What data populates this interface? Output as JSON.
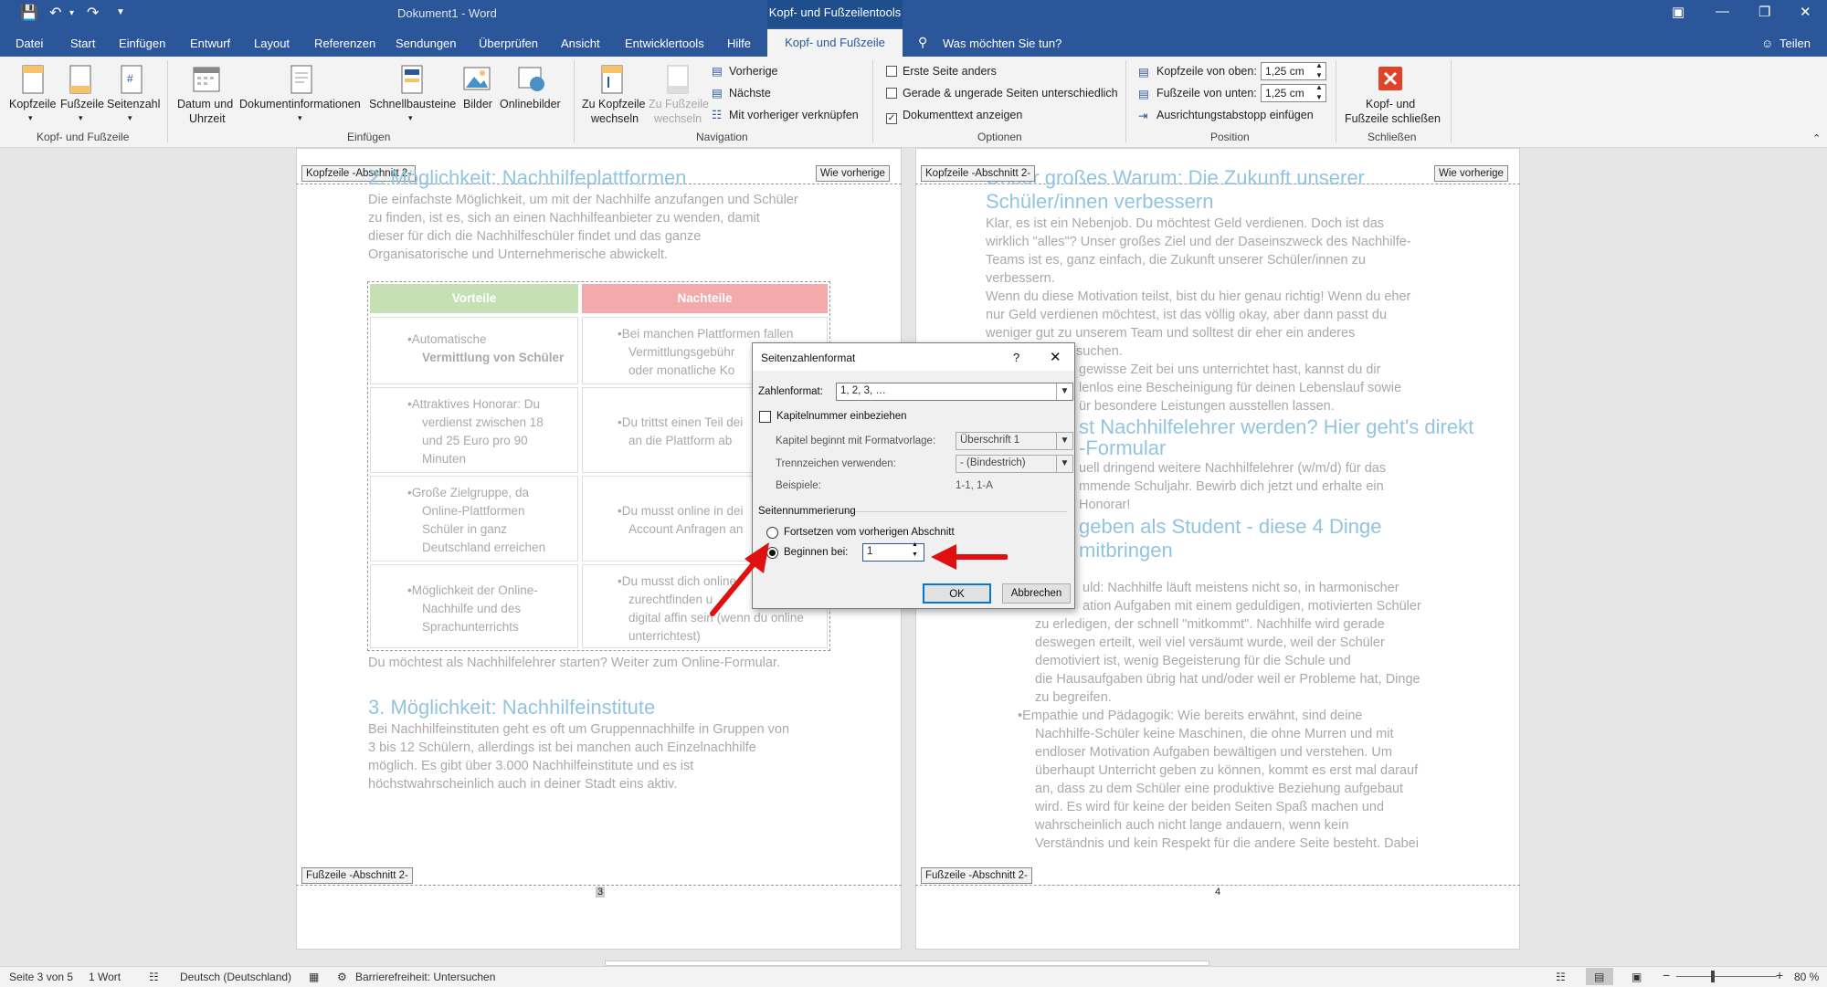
{
  "window": {
    "title": "Dokument1 - Word",
    "context_title": "Kopf- und Fußzeilentools"
  },
  "tabs": [
    "Datei",
    "Start",
    "Einfügen",
    "Entwurf",
    "Layout",
    "Referenzen",
    "Sendungen",
    "Überprüfen",
    "Ansicht",
    "Entwicklertools",
    "Hilfe"
  ],
  "active_tab": "Kopf- und Fußzeile",
  "tell_me": "Was möchten Sie tun?",
  "share": "Teilen",
  "ribbon": {
    "kopfzeile": "Kopfzeile",
    "fusszeile": "Fußzeile",
    "seitenzahl": "Seitenzahl",
    "grp_kf": "Kopf- und Fußzeile",
    "datum1": "Datum und",
    "datum2": "Uhrzeit",
    "dokinfo": "Dokumentinformationen",
    "schnell": "Schnellbausteine",
    "bilder": "Bilder",
    "online": "Onlinebilder",
    "grp_einf": "Einfügen",
    "zukopf1": "Zu Kopfzeile",
    "zukopf2": "wechseln",
    "zufuss1": "Zu Fußzeile",
    "zufuss2": "wechseln",
    "vorherige": "Vorherige",
    "naechste": "Nächste",
    "verknuepfen": "Mit vorheriger verknüpfen",
    "grp_nav": "Navigation",
    "opt1": "Erste Seite anders",
    "opt2": "Gerade & ungerade Seiten unterschiedlich",
    "opt3": "Dokumenttext anzeigen",
    "grp_opt": "Optionen",
    "kopfoben": "Kopfzeile von oben:",
    "kopfoben_val": "1,25 cm",
    "fussunten": "Fußzeile von unten:",
    "fussunten_val": "1,25 cm",
    "tabstopp": "Ausrichtungstabstopp einfügen",
    "grp_pos": "Position",
    "schliessen1": "Kopf- und",
    "schliessen2": "Fußzeile schließen",
    "grp_schl": "Schließen"
  },
  "page_left": {
    "header_tag": "Kopfzeile -Abschnitt 2-",
    "same_as_prev": "Wie vorherige",
    "heading1": "2. Möglichkeit: Nachhilfeplattformen",
    "para1": [
      "Die einfachste Möglichkeit, um mit der Nachhilfe anzufangen und Schüler",
      "zu finden, ist es, sich an einen Nachhilfeanbieter zu wenden, damit",
      "dieser für dich die Nachhilfeschüler findet und das ganze",
      "Organisatorische und Unternehmerische abwickelt."
    ],
    "table_head": [
      "Vorteile",
      "Nachteile"
    ],
    "table_left": [
      [
        "•Automatische",
        "Vermittlung von Schüler"
      ],
      [
        "•Attraktives Honorar: Du",
        "verdienst zwischen 18",
        "und 25 Euro pro 90",
        "Minuten"
      ],
      [
        "•Große Zielgruppe, da",
        "Online-Plattformen",
        "Schüler in ganz",
        "Deutschland erreichen"
      ],
      [
        "•Möglichkeit der Online-",
        "Nachhilfe und des",
        "Sprachunterrichts"
      ]
    ],
    "table_right": [
      [
        "•Bei manchen Plattformen fallen",
        "Vermittlungsgebühr",
        "oder monatliche Ko"
      ],
      [
        "•Du trittst einen Teil dei",
        "an die Plattform ab"
      ],
      [
        "•Du musst online in dei",
        "Account Anfragen an"
      ],
      [
        "•Du musst dich online",
        "zurechtfinden u",
        "digital affin sein (wenn du online",
        "unterrichtest)"
      ]
    ],
    "after_table": "Du möchtest als Nachhilfelehrer starten? Weiter zum Online-Formular.",
    "heading3": "3. Möglichkeit: Nachhilfeinstitute",
    "para3": [
      "Bei Nachhilfeinstituten geht es oft um Gruppennachhilfe in Gruppen von",
      "3 bis 12 Schülern, allerdings ist bei manchen auch Einzelnachhilfe",
      "möglich. Es gibt über 3.000 Nachhilfeinstitute und es ist",
      "höchstwahrscheinlich auch in deiner Stadt eins aktiv."
    ],
    "footer_tag": "Fußzeile -Abschnitt 2-",
    "page_num": "3"
  },
  "page_right": {
    "header_tag": "Kopfzeile -Abschnitt 2-",
    "same_as_prev": "Wie vorherige",
    "heading1a": "Unser großes Warum: Die Zukunft unserer",
    "heading1b": "Schüler/innen verbessern",
    "para1": [
      "Klar, es ist ein Nebenjob. Du möchtest Geld verdienen. Doch ist das",
      "wirklich \"alles\"? Unser großes Ziel und der Daseinszweck des Nachhilfe-",
      "Teams ist es, ganz einfach, die Zukunft unserer Schüler/innen zu",
      "verbessern.",
      "Wenn du diese Motivation teilst, bist du hier genau richtig! Wenn du eher",
      "nur Geld verdienen möchtest, ist das völlig okay, aber dann passt du",
      "weniger gut zu unserem Team und solltest dir eher ein anderes",
      "suchen."
    ],
    "para2": [
      "gewisse Zeit bei uns unterrichtet hast, kannst du dir",
      "lenlos eine Bescheinigung für deinen Lebenslauf sowie",
      "ür besondere Leistungen ausstellen lassen."
    ],
    "heading2a": "st Nachhilfelehrer werden? Hier geht's direkt",
    "heading2b": "-Formular",
    "para3": [
      "uell dringend weitere Nachhilfelehrer (w/m/d) für das",
      "mmende Schuljahr. Bewirb dich jetzt und erhalte ein",
      "Honorar!"
    ],
    "heading3a": "geben als Student - diese 4 Dinge",
    "heading3b": "mitbringen",
    "bullet1": [
      "uld: Nachhilfe läuft meistens nicht so, in harmonischer",
      "ation Aufgaben mit einem geduldigen, motivierten Schüler",
      "zu erledigen, der schnell \"mitkommt\". Nachhilfe wird gerade",
      "deswegen erteilt, weil viel versäumt wurde, weil der Schüler",
      "demotiviert ist, wenig Begeisterung für die Schule und",
      "die Hausaufgaben übrig hat und/oder weil er Probleme hat, Dinge",
      "zu begreifen."
    ],
    "bullet2": [
      "•Empathie und Pädagogik: Wie bereits erwähnt, sind deine",
      "Nachhilfe-Schüler keine Maschinen, die ohne Murren und mit",
      "endloser Motivation Aufgaben bewältigen und verstehen. Um",
      "überhaupt Unterricht geben zu können, kommt es erst mal darauf",
      "an, dass zu dem Schüler eine produktive Beziehung aufgebaut",
      "wird. Es wird für keine der beiden Seiten Spaß machen und",
      "wahrscheinlich auch nicht lange andauern, wenn kein",
      "Verständnis und kein Respekt für die andere Seite besteht. Dabei"
    ],
    "footer_tag": "Fußzeile -Abschnitt 2-",
    "page_num": "4"
  },
  "dialog": {
    "title": "Seitenzahlenformat",
    "help": "?",
    "close": "✕",
    "zahlenformat_label": "Zahlenformat:",
    "zahlenformat_val": "1, 2, 3, …",
    "kapitel_cb": "Kapitelnummer einbeziehen",
    "kapitel_beginnt": "Kapitel beginnt mit Formatvorlage:",
    "kapitel_beginnt_val": "Überschrift 1",
    "trenn": "Trennzeichen verwenden:",
    "trenn_val": "-    (Bindestrich)",
    "beispiele": "Beispiele:",
    "beispiele_val": "1-1, 1-A",
    "seitennum": "Seitennummerierung",
    "fortsetzen": "Fortsetzen vom vorherigen Abschnitt",
    "beginnen": "Beginnen bei:",
    "beginnen_val": "1",
    "ok": "OK",
    "abbrechen": "Abbrechen"
  },
  "status": {
    "page": "Seite 3 von 5",
    "words": "1 Wort",
    "lang": "Deutsch (Deutschland)",
    "access": "Barrierefreiheit: Untersuchen",
    "zoom": "80 %"
  },
  "colors": {
    "accent": "#2b579a",
    "table_pro": "#c5e0b3",
    "table_con": "#f4aaaa",
    "arrow": "#e01010",
    "heading": "#92c4e0"
  }
}
